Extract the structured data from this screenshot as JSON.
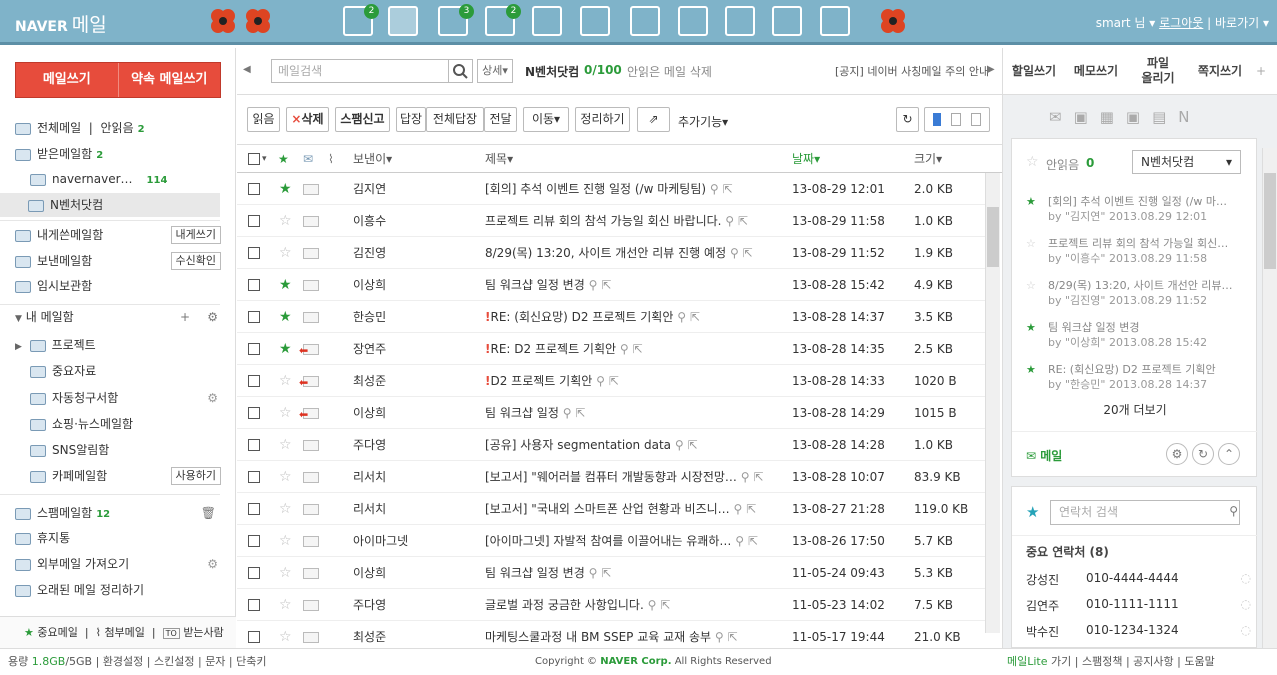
{
  "header": {
    "logo": "NAVER",
    "service": "메일",
    "user": "smart 님",
    "logout": "로그아웃",
    "shortcut": "바로가기",
    "badges": {
      "b1": "2",
      "b2": "3",
      "b3": "2"
    }
  },
  "left": {
    "write": "메일쓰기",
    "schedule": "약속 메일쓰기",
    "all": "전체메일",
    "unread_label": "안읽음",
    "unread_count": "2",
    "inbox": "받은메일함",
    "inbox_count": "2",
    "naver": "navernaver…",
    "naver_count": "114",
    "nventure": "N벤처닷컴",
    "self": "내게쓴메일함",
    "self_btn": "내게쓰기",
    "sent": "보낸메일함",
    "sent_btn": "수신확인",
    "draft": "임시보관함",
    "my": "내 메일함",
    "proj": "프로젝트",
    "imp": "중요자료",
    "auto": "자동청구서함",
    "shop": "쇼핑·뉴스메일함",
    "sns": "SNS알림함",
    "cafe": "카페메일함",
    "cafe_btn": "사용하기",
    "spam": "스팸메일함",
    "spam_count": "12",
    "trash": "휴지통",
    "ext": "외부메일 가져오기",
    "old": "오래된 메일 정리하기",
    "bottom": {
      "star": "중요메일",
      "attach": "첨부메일",
      "to": "받는사람"
    }
  },
  "mid": {
    "search_ph": "메일검색",
    "detail": "상세",
    "folder": "N벤처닷컴",
    "folder_count": "0/100",
    "folder_note": "안읽은 메일 삭제",
    "notice": "[공지] 네이버 사칭메일 주의 안내",
    "tb": {
      "read": "읽음",
      "delete": "삭제",
      "spam": "스팸신고",
      "reply": "답장",
      "replyall": "전체답장",
      "forward": "전달",
      "move": "이동",
      "tidy": "정리하기",
      "more": "추가기능"
    },
    "cols": {
      "sender": "보낸이",
      "subject": "제목",
      "date": "날짜",
      "size": "크기"
    },
    "rows": [
      {
        "sender": "김지연",
        "subj": "[회의] 추석 이벤트 진행 일정 (/w 마케팅팀)",
        "date": "13-08-29 12:01",
        "size": "2.0 KB",
        "star": true,
        "excl": false,
        "reply": false
      },
      {
        "sender": "이흥수",
        "subj": "프로젝트 리뷰 회의 참석 가능일 회신 바랍니다.",
        "date": "13-08-29 11:58",
        "size": "1.0 KB",
        "star": false,
        "excl": false,
        "reply": false
      },
      {
        "sender": "김진영",
        "subj": "8/29(목) 13:20, 사이트 개선안 리뷰 진행 예정",
        "date": "13-08-29 11:52",
        "size": "1.9 KB",
        "star": false,
        "excl": false,
        "reply": false
      },
      {
        "sender": "이상희",
        "subj": "팀 워크샵 일정 변경",
        "date": "13-08-28 15:42",
        "size": "4.9 KB",
        "star": true,
        "excl": false,
        "reply": false
      },
      {
        "sender": "한승민",
        "subj": "RE: (회신요망) D2 프로젝트 기획안",
        "date": "13-08-28 14:37",
        "size": "3.5 KB",
        "star": true,
        "excl": true,
        "reply": false
      },
      {
        "sender": "장연주",
        "subj": "RE: D2 프로젝트 기획안",
        "date": "13-08-28 14:35",
        "size": "2.5 KB",
        "star": true,
        "excl": true,
        "reply": true
      },
      {
        "sender": "최성준",
        "subj": "D2 프로젝트 기획안",
        "date": "13-08-28 14:33",
        "size": "1020 B",
        "star": false,
        "excl": true,
        "reply": true
      },
      {
        "sender": "이상희",
        "subj": "팀 워크샵 일정",
        "date": "13-08-28 14:29",
        "size": "1015 B",
        "star": false,
        "excl": false,
        "reply": true
      },
      {
        "sender": "주다영",
        "subj": "[공유] 사용자 segmentation data",
        "date": "13-08-28 14:28",
        "size": "1.0 KB",
        "star": false,
        "excl": false,
        "reply": false
      },
      {
        "sender": "리서치",
        "subj": "[보고서] \"웨어러블 컴퓨터 개발동향과 시장전망…",
        "date": "13-08-28 10:07",
        "size": "83.9 KB",
        "star": false,
        "excl": false,
        "reply": false
      },
      {
        "sender": "리서치",
        "subj": "[보고서] \"국내외 스마트폰 산업 현황과 비즈니…",
        "date": "13-08-27 21:28",
        "size": "119.0 KB",
        "star": false,
        "excl": false,
        "reply": false
      },
      {
        "sender": "아이마그넷",
        "subj": "[아이마그넷] 자발적 참여를 이끌어내는 유쾌하…",
        "date": "13-08-26 17:50",
        "size": "5.7 KB",
        "star": false,
        "excl": false,
        "reply": false
      },
      {
        "sender": "이상희",
        "subj": "팀 워크샵 일정 변경",
        "date": "11-05-24 09:43",
        "size": "5.3 KB",
        "star": false,
        "excl": false,
        "reply": false
      },
      {
        "sender": "주다영",
        "subj": "글로벌 과정 궁금한 사항입니다.",
        "date": "11-05-23 14:02",
        "size": "7.5 KB",
        "star": false,
        "excl": false,
        "reply": false
      },
      {
        "sender": "최성준",
        "subj": "마케팅스쿨과정 내 BM SSEP 교육 교재 송부",
        "date": "11-05-17 19:44",
        "size": "21.0 KB",
        "star": false,
        "excl": false,
        "reply": false
      }
    ]
  },
  "right": {
    "tabs": [
      "할일쓰기",
      "메모쓰기",
      "파일\n올리기",
      "쪽지쓰기"
    ],
    "unread": "안읽음",
    "unread_count": "0",
    "folder_select": "N벤처닷컴",
    "items": [
      {
        "subj": "[회의] 추석 이벤트 진행 일정 (/w 마…",
        "meta": "by \"김지연\" 2013.08.29 12:01",
        "star": true
      },
      {
        "subj": "프로젝트 리뷰 회의 참석 가능일 회신…",
        "meta": "by \"이흥수\" 2013.08.29 11:58",
        "star": false
      },
      {
        "subj": "8/29(목) 13:20, 사이트 개선안 리뷰…",
        "meta": "by \"김진영\" 2013.08.29 11:52",
        "star": false
      },
      {
        "subj": "팀 워크샵 일정 변경",
        "meta": "by \"이상희\" 2013.08.28 15:42",
        "star": true
      },
      {
        "subj": "RE: (회신요망) D2 프로젝트 기획안",
        "meta": "by \"한승민\" 2013.08.28 14:37",
        "star": true
      }
    ],
    "more": "20개 더보기",
    "mail": "메일",
    "contact_ph": "연락처 검색",
    "contacts_title": "중요 연락처 (8)",
    "contacts": [
      {
        "name": "강성진",
        "phone": "010-4444-4444"
      },
      {
        "name": "김연주",
        "phone": "010-1111-1111"
      },
      {
        "name": "박수진",
        "phone": "010-1234-1324"
      }
    ]
  },
  "footer": {
    "cap_label": "용량",
    "cap_used": "1.8GB",
    "cap_total": "/5GB",
    "settings": "환경설정",
    "skin": "스킨설정",
    "sms": "문자",
    "shortcut": "단축키",
    "copyright_pre": "Copyright ©",
    "corp": "NAVER Corp.",
    "rights": "All Rights Reserved",
    "lite": "메일Lite",
    "lite_go": "가기",
    "spam": "스팸정책",
    "notice": "공지사항",
    "help": "도움말"
  }
}
